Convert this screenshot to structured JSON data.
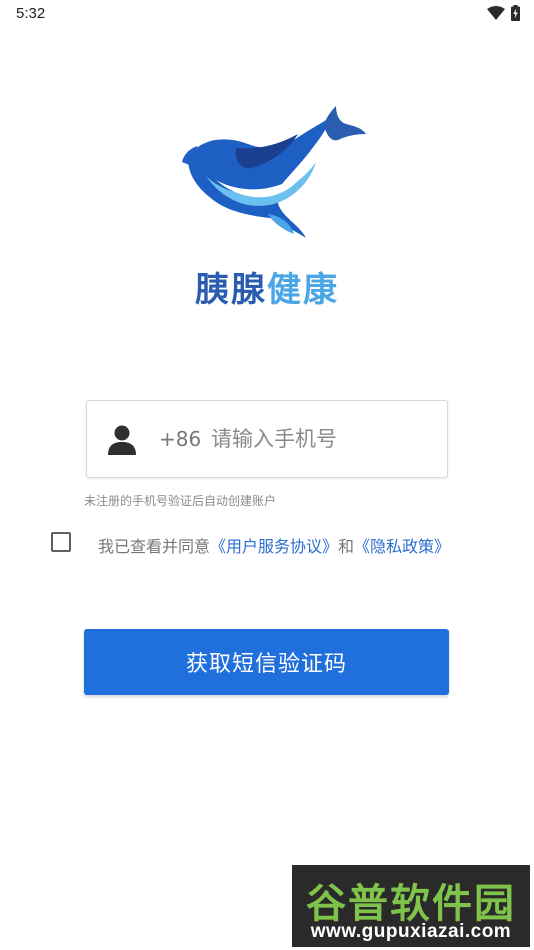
{
  "status_bar": {
    "time": "5:32"
  },
  "app": {
    "name_part1": "胰腺",
    "name_part2": "健康",
    "logo_icon": "whale-logo-icon",
    "colors": {
      "name_dark": "#2a5db0",
      "name_light": "#4aa6e6",
      "primary": "#1f6fdc",
      "link": "#2a6fd0"
    }
  },
  "login": {
    "country_code": "+86",
    "phone_placeholder": "请输入手机号",
    "phone_value": "",
    "hint": "未注册的手机号验证后自动创建账户",
    "agreement_prefix": "我已查看并同意",
    "user_agreement": "《用户服务协议》",
    "agreement_and": "和",
    "privacy_policy": "《隐私政策》",
    "agreement_checked": false,
    "submit_label": "获取短信验证码"
  },
  "watermark": {
    "title": "谷普软件园",
    "url": "www.gupuxiazai.com"
  }
}
